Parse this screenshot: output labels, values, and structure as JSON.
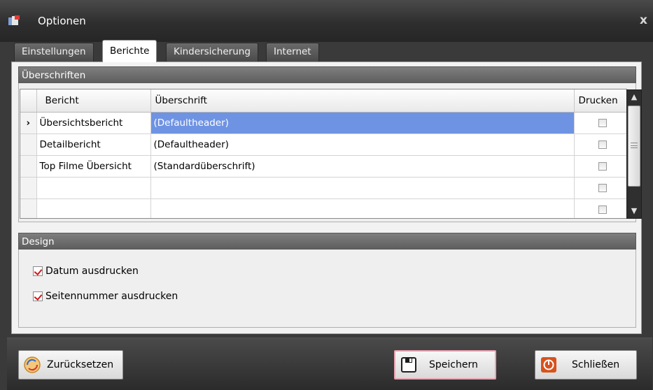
{
  "window": {
    "title": "Optionen",
    "close_glyph": "x"
  },
  "tabs": [
    {
      "label": "Einstellungen",
      "active": false
    },
    {
      "label": "Berichte",
      "active": true
    },
    {
      "label": "Kindersicherung",
      "active": false
    },
    {
      "label": "Internet",
      "active": false
    }
  ],
  "headings_group": {
    "title": "Überschriften"
  },
  "grid": {
    "columns": [
      "Bericht",
      "Überschrift",
      "Drucken"
    ],
    "current_row_glyph": "›",
    "rows": [
      {
        "bericht": "Übersichtsbericht",
        "ueberschrift": "(Defaultheader)",
        "drucken": false,
        "selected": true
      },
      {
        "bericht": "Detailbericht",
        "ueberschrift": "(Defaultheader)",
        "drucken": false,
        "selected": false
      },
      {
        "bericht": "Top Filme Übersicht",
        "ueberschrift": "(Standardüberschrift)",
        "drucken": false,
        "selected": false
      },
      {
        "bericht": "",
        "ueberschrift": "",
        "drucken": false,
        "selected": false
      },
      {
        "bericht": "",
        "ueberschrift": "",
        "drucken": false,
        "selected": false
      }
    ],
    "scroll_up_glyph": "▲",
    "scroll_down_glyph": "▼"
  },
  "design_group": {
    "title": "Design",
    "options": [
      {
        "label": "Datum ausdrucken",
        "checked": true
      },
      {
        "label": "Seitennummer ausdrucken",
        "checked": true
      }
    ]
  },
  "buttons": {
    "reset": {
      "label": "Zurücksetzen",
      "icon": "reset-icon"
    },
    "save": {
      "label": "Speichern",
      "icon": "floppy-disk-icon"
    },
    "close": {
      "label": "Schließen",
      "icon": "power-icon"
    }
  },
  "colors": {
    "selection": "#6f93e3",
    "check_mark": "#d11a1a",
    "header_bar": "#6e6e6e",
    "save_border": "#e9a3b2",
    "close_icon": "#d8521c"
  }
}
